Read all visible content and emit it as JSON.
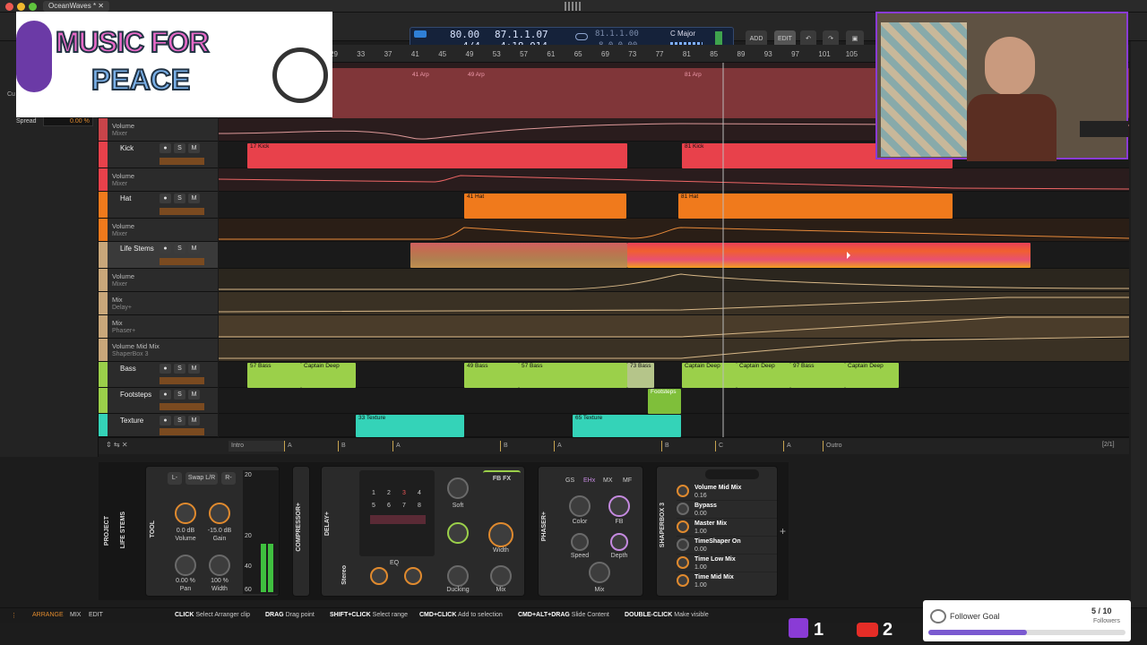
{
  "window": {
    "tab_title": "OceanWaves *"
  },
  "transport": {
    "tempo": "80.00",
    "signature": "4/4",
    "position": "87.1.1.07",
    "time": "4:18.014",
    "loop_start": "81.1.1.00",
    "loop_len": "8.0.0.00",
    "key": "C Major",
    "add": "ADD",
    "edit": "EDIT"
  },
  "inspector": {
    "spread_label": "Spread",
    "spread_value": "0.00 %",
    "cue": "Cu"
  },
  "ruler": [
    "29",
    "33",
    "37",
    "41",
    "45",
    "49",
    "53",
    "57",
    "61",
    "65",
    "69",
    "73",
    "77",
    "81",
    "85",
    "89",
    "93",
    "97",
    "101",
    "105"
  ],
  "tracks": [
    {
      "name": "Volume",
      "sub": "Mixer"
    },
    {
      "name": "Kick",
      "sub": ""
    },
    {
      "name": "Volume",
      "sub": "Mixer"
    },
    {
      "name": "Hat",
      "sub": ""
    },
    {
      "name": "Volume",
      "sub": "Mixer"
    },
    {
      "name": "Life Stems",
      "sub": ""
    },
    {
      "name": "Volume",
      "sub": "Mixer"
    },
    {
      "name": "Mix",
      "sub": "Delay+"
    },
    {
      "name": "Mix",
      "sub": "Phaser+"
    },
    {
      "name": "Volume Mid Mix",
      "sub": "ShaperBox 3"
    },
    {
      "name": "Bass",
      "sub": ""
    },
    {
      "name": "Footsteps",
      "sub": ""
    },
    {
      "name": "Texture",
      "sub": ""
    }
  ],
  "clips": {
    "arp1": "41 Arp",
    "arp2": "49 Arp",
    "arp3": "81 Arp",
    "kick1": "17 Kick",
    "kick2": "81 Kick",
    "hat1": "41 Hat",
    "hat2": "81 Hat",
    "bass": [
      "57 Bass",
      "Captain Deep",
      "49 Bass",
      "57 Bass",
      "73 Bass",
      "Captain Deep",
      "Captain Deep",
      "97 Bass",
      "Captain Deep"
    ],
    "footsteps": "Footsteps",
    "texture": [
      "33 Texture",
      "65 Texture"
    ]
  },
  "markers": [
    "Intro",
    "A",
    "B",
    "A",
    "B",
    "A",
    "B",
    "C",
    "A",
    "Outro"
  ],
  "marker_count": "[2/1]",
  "devices": {
    "project": "PROJECT",
    "life_stems": "LIFE STEMS",
    "tool": {
      "title": "TOOL",
      "l": "L-",
      "swap": "Swap L/R",
      "r": "R-",
      "vol_val": "0.0 dB",
      "vol": "Volume",
      "gain_val": "-15.0 dB",
      "gain": "Gain",
      "pan_val": "0.00 %",
      "pan": "Pan",
      "width_val": "100 %",
      "width": "Width"
    },
    "meter": [
      "20",
      "20",
      "40",
      "60"
    ],
    "compressor": "COMPRESSOR+",
    "delay": {
      "title": "DELAY+",
      "stereo": "Stereo",
      "eq": "EQ",
      "soft": "Soft",
      "width": "Width",
      "ducking": "Ducking",
      "mix": "Mix",
      "fbfx": "FB FX",
      "nums": [
        "1",
        "2",
        "3",
        "4",
        "5",
        "6",
        "7",
        "8"
      ]
    },
    "phaser": {
      "title": "PHASER+",
      "tabs": [
        "GS",
        "EHx",
        "MX",
        "MF"
      ],
      "color": "Color",
      "fb": "FB",
      "speed": "Speed",
      "depth": "Depth",
      "mix": "Mix"
    },
    "shaperbox": {
      "title": "SHAPERBOX 3",
      "params": [
        {
          "n": "Volume Mid Mix",
          "v": "0.16"
        },
        {
          "n": "Bypass",
          "v": "0.00"
        },
        {
          "n": "Master Mix",
          "v": "1.00"
        },
        {
          "n": "TimeShaper On",
          "v": "0.00"
        },
        {
          "n": "Time Low Mix",
          "v": "1.00"
        },
        {
          "n": "Time Mid Mix",
          "v": "1.00"
        }
      ]
    }
  },
  "statusbar": {
    "arrange": "ARRANGE",
    "mix": "MIX",
    "edit": "EDIT",
    "hints": [
      {
        "k": "CLICK",
        "t": "Select Arranger clip"
      },
      {
        "k": "DRAG",
        "t": "Drag point"
      },
      {
        "k": "SHIFT+CLICK",
        "t": "Select range"
      },
      {
        "k": "CMD+CLICK",
        "t": "Add to selection"
      },
      {
        "k": "CMD+ALT+DRAG",
        "t": "Slide Content"
      },
      {
        "k": "DOUBLE-CLICK",
        "t": "Make visible"
      }
    ]
  },
  "overlay": {
    "line1": "MUSIC FOR",
    "line2": "PEACE"
  },
  "social": {
    "twitch": "1",
    "youtube": "2"
  },
  "follower_goal": {
    "label": "Follower Goal",
    "count": "5 / 10",
    "sub": "Followers",
    "progress": 0.5
  },
  "colors": {
    "kick": "#e8414b",
    "hat": "#f07a1c",
    "stems": "#c9a77a",
    "bass": "#9bd04a",
    "texture": "#34d3b8",
    "arp": "#c8444a"
  }
}
